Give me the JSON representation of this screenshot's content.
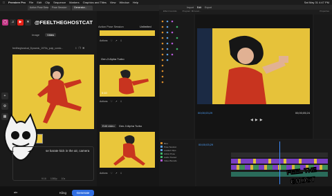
{
  "menubar": {
    "items": [
      "Premiere Pro",
      "File",
      "Edit",
      "Clip",
      "Sequence",
      "Markers",
      "Graphics and Titles",
      "View",
      "Window",
      "Help"
    ],
    "datetime": "Sat May 31 4:47 PM"
  },
  "browser_tabs": [
    "Action Pose Session",
    "Pose Session",
    "Generator..."
  ],
  "social": {
    "handle": "@FEELTHEGHOSTCAT",
    "icons": [
      "instagram-icon",
      "tiktok-icon",
      "youtube-icon",
      "x-icon"
    ]
  },
  "left_panel": {
    "toggle_image": "Image",
    "toggle_video": "Video",
    "filename": "feeltheghostcat_Dynamic_1970s_pulp_comic...",
    "prompt_text": "se karate kick in the air, camera",
    "prompt_label": "ain",
    "model_label": "Kling",
    "generate_label": "Generate",
    "prompt_options": [
      "9:16",
      "1080p",
      "10s"
    ]
  },
  "mid_panel": {
    "session_title": "Action Pose Session",
    "unlimited_label": "Unlimited",
    "actions_label": "Actions",
    "card1_label": "Gen-3 Alpha Turbo",
    "card2_prefix": "Edit video",
    "card2_label": "Gen-3 Alpha Turbo",
    "time_overlay": "0:10"
  },
  "premiere": {
    "header_tabs": [
      "Import",
      "Edit",
      "Export"
    ],
    "active_tab": "Edit",
    "project_label": "Program: Mirrored...",
    "effects_label": "Effect Controls",
    "timecode_left": "00;00;03;29",
    "timecode_right": "00;00;05;24",
    "timeline_timecode": "00;00;03;29",
    "properties_label": "Properties",
    "project_items": [
      "Bins",
      "Pose Session",
      "Loaded Clips",
      "Action Pose",
      "Audio Transcr",
      "Video Bounds"
    ],
    "graffiti_text": "FEEL THE GHOST"
  },
  "colors": {
    "accent_blue": "#2f6de1",
    "poster_yellow": "#e9c63b",
    "timecode_blue": "#4fa3ff"
  }
}
